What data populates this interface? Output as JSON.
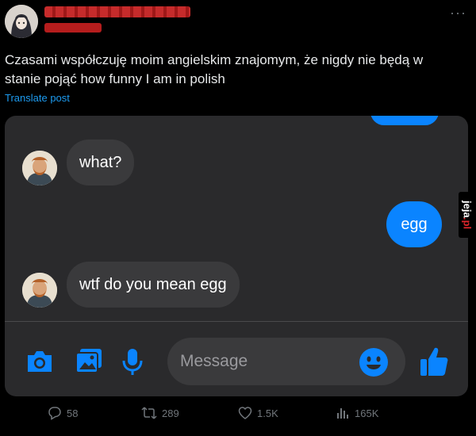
{
  "post": {
    "text_line1": "Czasami współczuję moim angielskim znajomym, że nigdy nie będą w",
    "text_line2": "stanie pojąć how funny I am in polish",
    "translate_label": "Translate post"
  },
  "messages": [
    {
      "direction": "incoming",
      "text": "what?"
    },
    {
      "direction": "outgoing",
      "text": "egg"
    },
    {
      "direction": "incoming",
      "text": "wtf do you mean egg"
    }
  ],
  "composer": {
    "placeholder": "Message"
  },
  "watermark": {
    "text_main": "jeja",
    "text_accent": ".pl"
  },
  "stats": {
    "replies": "58",
    "reposts": "289",
    "likes": "1.5K",
    "views": "165K"
  },
  "colors": {
    "accent": "#1d9bf0",
    "bubble_out": "#0a84ff",
    "bubble_in": "#3a3a3c",
    "chat_bg": "#2a2a2c"
  },
  "icons": [
    "more-icon",
    "camera-icon",
    "photo-icon",
    "microphone-icon",
    "emoji-icon",
    "thumbs-up-icon",
    "reply-icon",
    "repost-icon",
    "like-icon",
    "views-icon"
  ]
}
